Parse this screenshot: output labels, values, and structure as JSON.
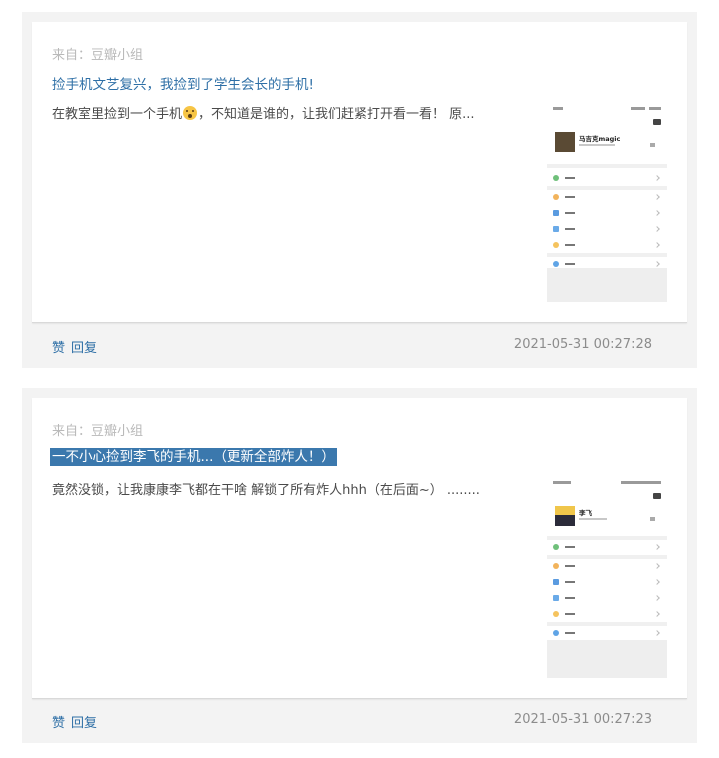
{
  "posts": [
    {
      "source": "来自：豆瓣小组",
      "title": "捡手机文艺复兴，我捡到了学生会长的手机!",
      "excerpt_before": "在教室里捡到一个手机",
      "excerpt_after": "，不知道是谁的，让我们赶紧打开看一看！ 原...",
      "emoji": "astonished-face-icon",
      "thumb_name": "马吉克magic",
      "like": "赞",
      "reply": "回复",
      "time": "2021-05-31 00:27:28"
    },
    {
      "source": "来自：豆瓣小组",
      "title": "一不小心捡到李飞的手机...（更新全部炸人！）",
      "excerpt_before": "竟然没锁，让我康康李飞都在干啥 解锁了所有炸人hhh（在后面~） ........",
      "excerpt_after": "",
      "thumb_name": "李飞",
      "like": "赞",
      "reply": "回复",
      "time": "2021-05-31 00:27:23"
    }
  ],
  "colors": {
    "card_bg": "#f3f3f3",
    "link": "#2e6fa6",
    "selection": "#3b78ad"
  }
}
